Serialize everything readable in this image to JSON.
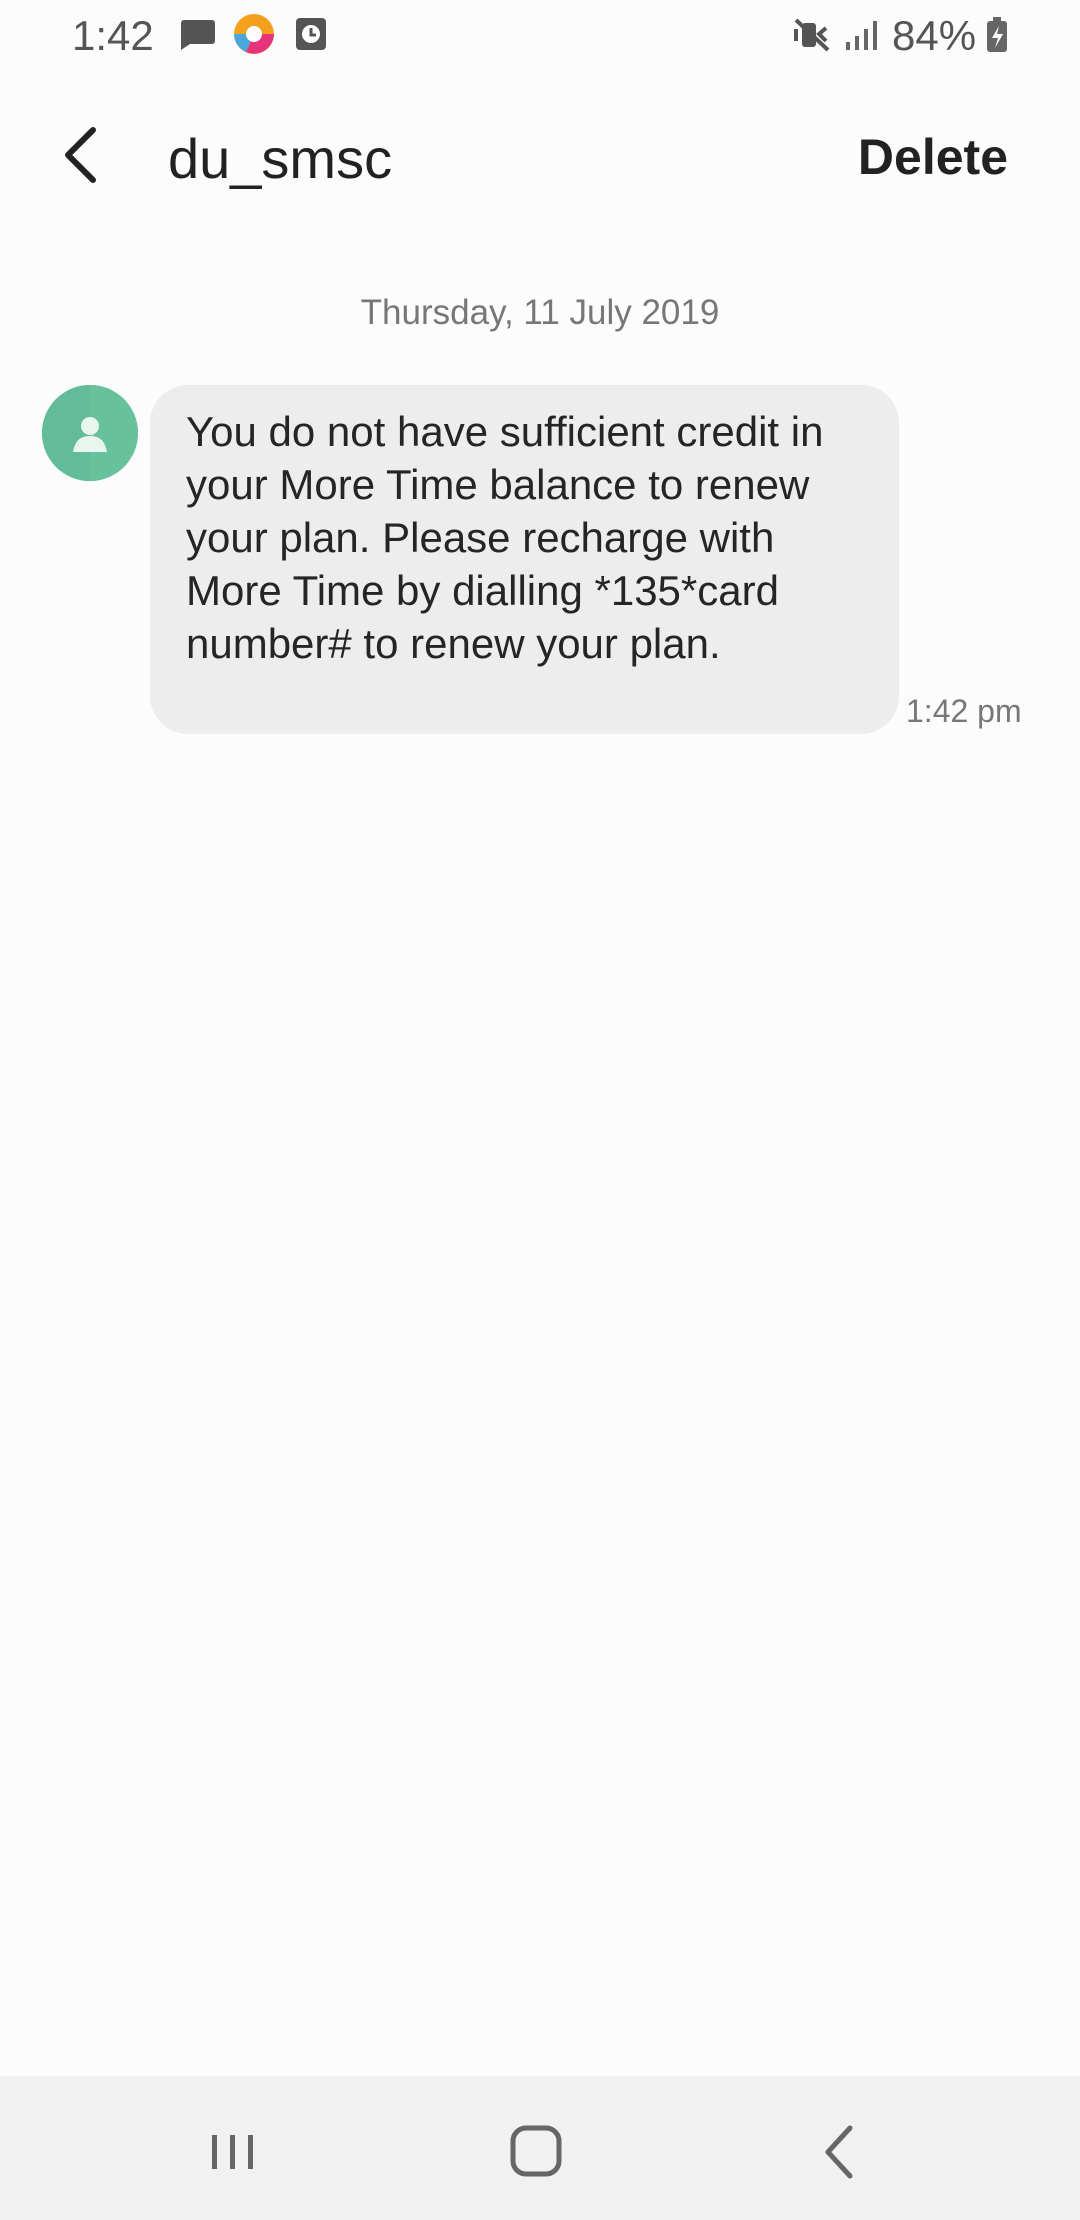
{
  "status_bar": {
    "time": "1:42",
    "battery_percent": "84%",
    "icons": [
      "message-notification-icon",
      "colorful-app-icon",
      "clock-notification-icon",
      "mute-icon",
      "signal-icon",
      "battery-charging-icon"
    ]
  },
  "header": {
    "contact_name": "du_smsc",
    "delete_label": "Delete",
    "back_icon": "back-arrow-icon"
  },
  "conversation": {
    "date": "Thursday, 11 July 2019",
    "messages": [
      {
        "text": "You do not have sufficient credit in your More Time balance to renew your plan. Please recharge with More Time by dialling *135*card number# to renew your plan.",
        "time": "1:42 pm",
        "direction": "incoming"
      }
    ]
  },
  "navigation": {
    "icons": [
      "recents-icon",
      "home-icon",
      "back-icon"
    ]
  },
  "colors": {
    "avatar": "#67c29c",
    "bubble": "#ededed",
    "background": "#fcfcfc",
    "nav_bar": "#f1f1f1"
  }
}
